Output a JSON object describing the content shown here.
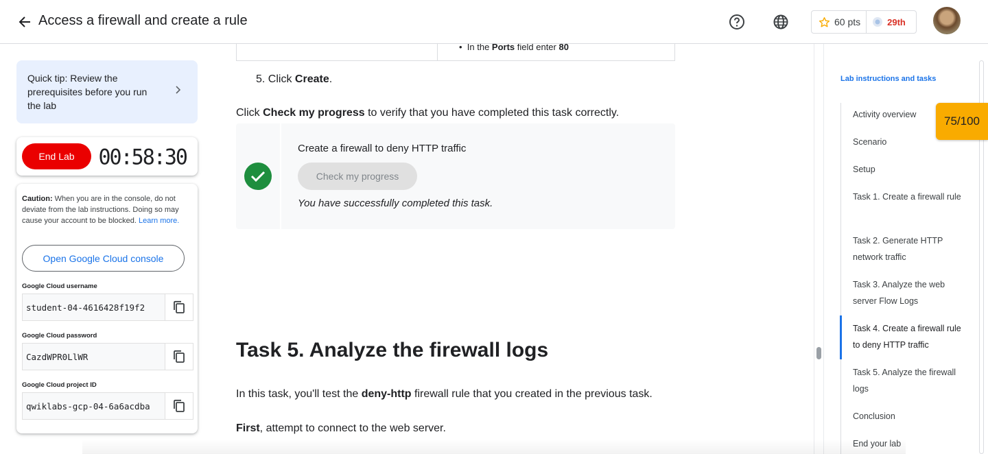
{
  "header": {
    "title": "Access a firewall and create a rule",
    "points": "60 pts",
    "rank": "29th"
  },
  "tip": {
    "text": "Quick tip: Review the prerequisites before you run the lab"
  },
  "lab_controls": {
    "end_lab_label": "End Lab",
    "timer": "00:58:30"
  },
  "credentials": {
    "caution_bold": "Caution:",
    "caution_text": " When you are in the console, do not deviate from the lab instructions. Doing so may cause your account to be blocked. ",
    "learn_more": "Learn more.",
    "console_button": "Open Google Cloud console",
    "username_label": "Google Cloud username",
    "username_value": "student-04-4616428f19f2",
    "password_label": "Google Cloud password",
    "password_value": "CazdWPR0LlWR",
    "project_label": "Google Cloud project ID",
    "project_value": "qwiklabs-gcp-04-6a6acdba"
  },
  "content": {
    "table_bullet_pre": "In the ",
    "table_bullet_bold1": "Ports",
    "table_bullet_mid": " field enter ",
    "table_bullet_bold2": "80",
    "step5_num": "5. Click ",
    "step5_bold": "Create",
    "step5_end": ".",
    "check_pre": "Click ",
    "check_bold": "Check my progress",
    "check_post": " to verify that you have completed this task correctly.",
    "progress_title": "Create a firewall to deny HTTP traffic",
    "progress_button": "Check my progress",
    "progress_success": "You have successfully completed this task.",
    "task_heading": "Task 5. Analyze the firewall logs",
    "para1_pre": "In this task, you'll test the ",
    "para1_bold": "deny-http",
    "para1_post": " firewall rule that you created in the previous task.",
    "para2_bold": "First",
    "para2_post": ", attempt to connect to the web server."
  },
  "toc": {
    "heading": "Lab instructions and tasks",
    "items": [
      "Activity overview",
      "Scenario",
      "Setup",
      "Task 1. Create a firewall rule",
      "Task 2. Generate HTTP network traffic",
      "Task 3. Analyze the web server Flow Logs",
      "Task 4. Create a firewall rule to deny HTTP traffic",
      "Task 5. Analyze the firewall logs",
      "Conclusion",
      "End your lab"
    ],
    "active_index": 6
  },
  "score": "75/100",
  "colors": {
    "accent": "#1a73e8",
    "end_lab": "#ea0000",
    "success": "#1e8e3e",
    "score_badge": "#f9ab00",
    "rank": "#d93025"
  },
  "icons": {
    "back": "arrow-left-icon",
    "help": "help-circle-icon",
    "language": "globe-icon",
    "points": "star-icon",
    "rank": "league-badge-icon",
    "copy": "copy-icon",
    "tip": "chevron-right-icon",
    "progress": "check-circle-icon"
  }
}
